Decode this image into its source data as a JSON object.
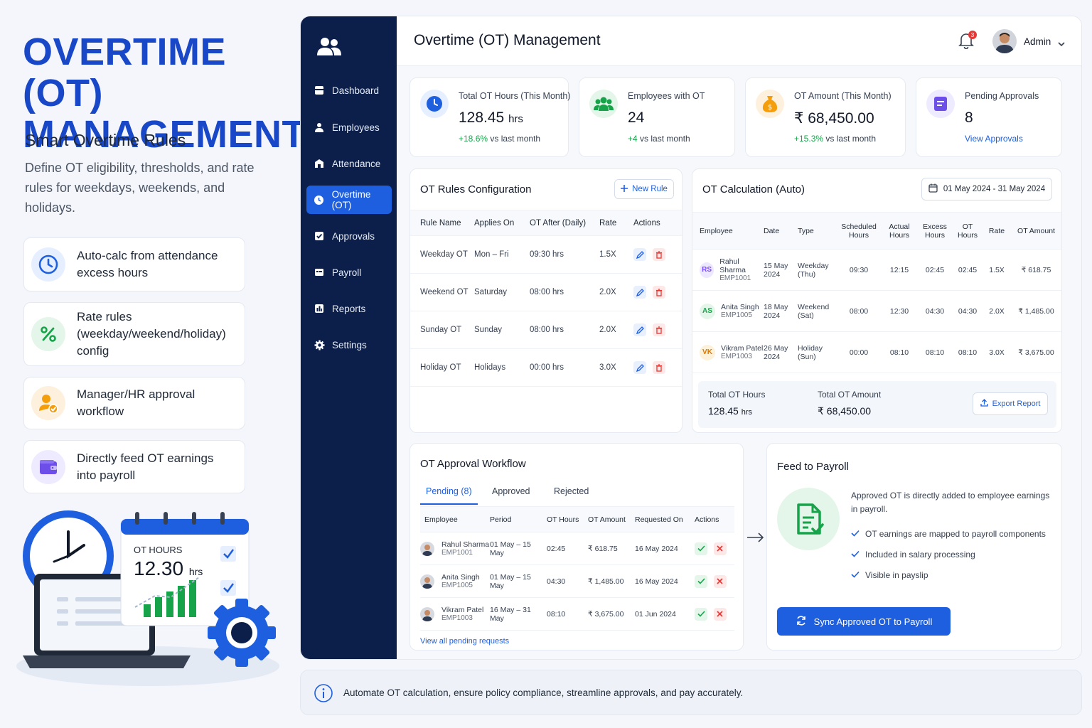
{
  "promo": {
    "title": "OVERTIME (OT) MANAGEMENT",
    "subtitle": "Smart Overtime Rules",
    "description": "Define OT eligibility, thresholds, and rate rules for weekdays, weekends, and holidays.",
    "features": [
      {
        "icon": "clock-icon",
        "text": "Auto-calc from attendance excess hours"
      },
      {
        "icon": "percent-icon",
        "text": "Rate rules (weekday/weekend/holiday) config"
      },
      {
        "icon": "approval-user-icon",
        "text": "Manager/HR approval workflow"
      },
      {
        "icon": "wallet-icon",
        "text": "Directly feed OT earnings into payroll"
      }
    ],
    "illustration": {
      "label": "OT HOURS",
      "value": "12.30",
      "unit": "hrs"
    }
  },
  "sidebar": {
    "items": [
      {
        "label": "Dashboard",
        "icon": "dashboard-icon"
      },
      {
        "label": "Employees",
        "icon": "user-icon"
      },
      {
        "label": "Attendance",
        "icon": "attendance-icon"
      },
      {
        "label": "Overtime (OT)",
        "icon": "clock-icon",
        "active": true
      },
      {
        "label": "Approvals",
        "icon": "check-square-icon"
      },
      {
        "label": "Payroll",
        "icon": "payroll-icon"
      },
      {
        "label": "Reports",
        "icon": "reports-icon"
      },
      {
        "label": "Settings",
        "icon": "gear-icon"
      }
    ]
  },
  "header": {
    "title": "Overtime (OT) Management",
    "notifications": "3",
    "user": "Admin"
  },
  "stats": [
    {
      "label": "Total OT Hours (This Month)",
      "value": "128.45",
      "unit": "hrs",
      "change": "+18.6%",
      "change_text": "vs last month"
    },
    {
      "label": "Employees with OT",
      "value": "24",
      "unit": "",
      "change": "+4",
      "change_text": "vs last month"
    },
    {
      "label": "OT Amount (This Month)",
      "value": "₹ 68,450.00",
      "unit": "",
      "change": "+15.3%",
      "change_text": "vs last month"
    },
    {
      "label": "Pending Approvals",
      "value": "8",
      "unit": "",
      "link": "View Approvals"
    }
  ],
  "rules": {
    "title": "OT Rules Configuration",
    "new_button": "New Rule",
    "columns": [
      "Rule Name",
      "Applies On",
      "OT After (Daily)",
      "Rate",
      "Actions"
    ],
    "rows": [
      {
        "name": "Weekday OT",
        "applies": "Mon – Fri",
        "after": "09:30 hrs",
        "rate": "1.5X"
      },
      {
        "name": "Weekend OT",
        "applies": "Saturday",
        "after": "08:00 hrs",
        "rate": "2.0X"
      },
      {
        "name": "Sunday OT",
        "applies": "Sunday",
        "after": "08:00 hrs",
        "rate": "2.0X"
      },
      {
        "name": "Holiday OT",
        "applies": "Holidays",
        "after": "00:00 hrs",
        "rate": "3.0X"
      }
    ]
  },
  "calc": {
    "title": "OT Calculation (Auto)",
    "date_range": "01 May 2024 - 31 May 2024",
    "columns": [
      "Employee",
      "Date",
      "Type",
      "Scheduled Hours",
      "Actual Hours",
      "Excess Hours",
      "OT Hours",
      "Rate",
      "OT Amount"
    ],
    "rows": [
      {
        "initials": "RS",
        "name": "Rahul Sharma",
        "id": "EMP1001",
        "date1": "15 May",
        "date2": "2024",
        "type1": "Weekday",
        "type2": "(Thu)",
        "scheduled": "09:30",
        "actual": "12:15",
        "excess": "02:45",
        "ot": "02:45",
        "rate": "1.5X",
        "amount": "₹ 618.75",
        "color": "#7c4dff",
        "bg": "#ede7ff"
      },
      {
        "initials": "AS",
        "name": "Anita Singh",
        "id": "EMP1005",
        "date1": "18 May",
        "date2": "2024",
        "type1": "Weekend",
        "type2": "(Sat)",
        "scheduled": "08:00",
        "actual": "12:30",
        "excess": "04:30",
        "ot": "04:30",
        "rate": "2.0X",
        "amount": "₹ 1,485.00",
        "color": "#16a34a",
        "bg": "#e3f6e9"
      },
      {
        "initials": "VK",
        "name": "Vikram Patel",
        "id": "EMP1003",
        "date1": "26 May",
        "date2": "2024",
        "type1": "Holiday",
        "type2": "(Sun)",
        "scheduled": "00:00",
        "actual": "08:10",
        "excess": "08:10",
        "ot": "08:10",
        "rate": "3.0X",
        "amount": "₹ 3,675.00",
        "color": "#d97706",
        "bg": "#fdf2d9"
      }
    ],
    "total_hours_label": "Total OT Hours",
    "total_hours": "128.45",
    "total_hours_unit": "hrs",
    "total_amount_label": "Total OT Amount",
    "total_amount": "₹ 68,450.00",
    "export_button": "Export Report"
  },
  "workflow": {
    "title": "OT Approval Workflow",
    "tabs": [
      "Pending (8)",
      "Approved",
      "Rejected"
    ],
    "columns": [
      "Employee",
      "Period",
      "OT Hours",
      "OT Amount",
      "Requested On",
      "Actions"
    ],
    "rows": [
      {
        "name": "Rahul Sharma",
        "id": "EMP1001",
        "period": "01 May – 15 May",
        "hours": "02:45",
        "amount": "₹ 618.75",
        "requested": "16 May 2024"
      },
      {
        "name": "Anita Singh",
        "id": "EMP1005",
        "period": "01 May – 15 May",
        "hours": "04:30",
        "amount": "₹ 1,485.00",
        "requested": "16 May 2024"
      },
      {
        "name": "Vikram Patel",
        "id": "EMP1003",
        "period": "16 May – 31 May",
        "hours": "08:10",
        "amount": "₹ 3,675.00",
        "requested": "01 Jun 2024"
      }
    ],
    "view_all": "View all pending requests"
  },
  "payroll": {
    "title": "Feed to Payroll",
    "description": "Approved OT is directly added to employee earnings in payroll.",
    "checks": [
      "OT earnings are mapped to payroll components",
      "Included in salary processing",
      "Visible in payslip"
    ],
    "sync_button": "Sync Approved OT to Payroll"
  },
  "footer": {
    "text": "Automate OT calculation, ensure policy compliance, streamline approvals, and pay accurately."
  },
  "colors": {
    "brand": "#1847c7",
    "accent": "#1e5fe0",
    "sidebar": "#0b1f4a",
    "positive": "#16a34a",
    "danger": "#e53935"
  }
}
